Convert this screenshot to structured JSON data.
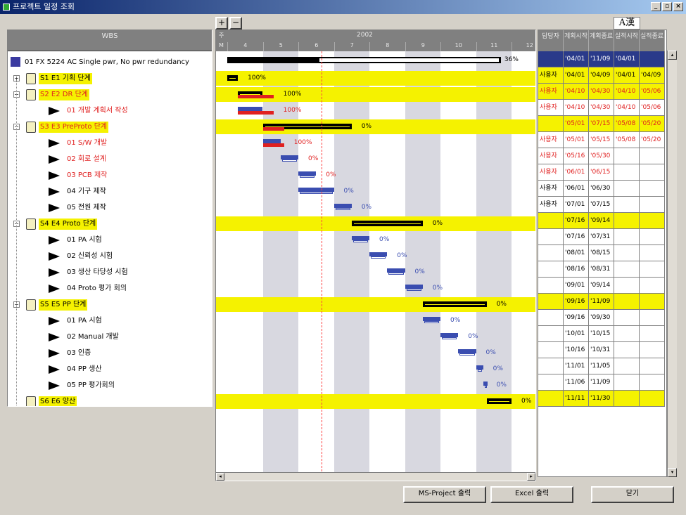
{
  "window": {
    "title": "프로젝트 일정 조회",
    "buttons": [
      "_",
      "▫",
      "×"
    ]
  },
  "ime": "A漢",
  "zoom": {
    "plus": "+",
    "minus": "−"
  },
  "wbs": {
    "header": "WBS",
    "project": "01 FX 5224 AC Single pwr, No pwr redundancy",
    "rows": [
      {
        "label": "S1 E1 기획 단계",
        "level": 0,
        "hl": true,
        "red": false,
        "toggle": "+"
      },
      {
        "label": "S2 E2 DR 단계",
        "level": 0,
        "hl": true,
        "red": true,
        "toggle": "−"
      },
      {
        "label": "01 개발 계획서 작성",
        "level": 1,
        "hl": false,
        "red": true
      },
      {
        "label": "S3 E3 PreProto 단계",
        "level": 0,
        "hl": true,
        "red": true,
        "toggle": "−"
      },
      {
        "label": "01 S/W 개발",
        "level": 1,
        "hl": false,
        "red": true
      },
      {
        "label": "02 회로 설계",
        "level": 1,
        "hl": false,
        "red": true
      },
      {
        "label": "03 PCB 제작",
        "level": 1,
        "hl": false,
        "red": true
      },
      {
        "label": "04 기구 제작",
        "level": 1,
        "hl": false,
        "red": false
      },
      {
        "label": "05 전원 제작",
        "level": 1,
        "hl": false,
        "red": false
      },
      {
        "label": "S4 E4 Proto 단계",
        "level": 0,
        "hl": true,
        "red": false,
        "toggle": "−"
      },
      {
        "label": "01 PA 시험",
        "level": 1,
        "hl": false,
        "red": false
      },
      {
        "label": "02 신뢰성 시험",
        "level": 1,
        "hl": false,
        "red": false
      },
      {
        "label": "03 생산 타당성 시험",
        "level": 1,
        "hl": false,
        "red": false
      },
      {
        "label": "04 Proto 평가 회의",
        "level": 1,
        "hl": false,
        "red": false
      },
      {
        "label": "S5 E5 PP 단계",
        "level": 0,
        "hl": true,
        "red": false,
        "toggle": "−"
      },
      {
        "label": "01 PA 시험",
        "level": 1,
        "hl": false,
        "red": false
      },
      {
        "label": "02 Manual 개발",
        "level": 1,
        "hl": false,
        "red": false
      },
      {
        "label": "03 인증",
        "level": 1,
        "hl": false,
        "red": false
      },
      {
        "label": "04 PP 생산",
        "level": 1,
        "hl": false,
        "red": false
      },
      {
        "label": "05 PP 평가회의",
        "level": 1,
        "hl": false,
        "red": false
      },
      {
        "label": "S6 E6 양산",
        "level": 0,
        "hl": true,
        "red": false,
        "toggle": ""
      }
    ]
  },
  "gantt": {
    "year": "2002",
    "row_marks": [
      "주",
      "M"
    ],
    "months": [
      "4",
      "5",
      "6",
      "7",
      "8",
      "9",
      "10",
      "11",
      "12"
    ],
    "summary_pct": "36%",
    "rows": [
      {
        "pct": "100%",
        "plan": [
          0.0,
          0.3
        ],
        "actual": null,
        "summary": true
      },
      {
        "pct": "100%",
        "plan": [
          0.3,
          1.0
        ],
        "actual": [
          0.3,
          1.3
        ],
        "summary": true
      },
      {
        "pct": "100%",
        "plan": [
          0.3,
          1.0
        ],
        "actual": [
          0.3,
          1.3
        ],
        "summary": false
      },
      {
        "pct": "0%",
        "plan": [
          1.0,
          3.5
        ],
        "actual": [
          1.0,
          1.6
        ],
        "summary": true
      },
      {
        "pct": "100%",
        "plan": [
          1.0,
          1.5
        ],
        "actual": [
          1.0,
          1.6
        ],
        "summary": false
      },
      {
        "pct": "0%",
        "plan": [
          1.5,
          2.0
        ],
        "actual": null,
        "summary": false
      },
      {
        "pct": "0%",
        "plan": [
          2.0,
          2.5
        ],
        "actual": null,
        "summary": false
      },
      {
        "pct": "0%",
        "plan": [
          2.0,
          3.0
        ],
        "actual": null,
        "summary": false
      },
      {
        "pct": "0%",
        "plan": [
          3.0,
          3.5
        ],
        "actual": null,
        "summary": false
      },
      {
        "pct": "0%",
        "plan": [
          3.5,
          5.5
        ],
        "actual": null,
        "summary": true
      },
      {
        "pct": "0%",
        "plan": [
          3.5,
          4.0
        ],
        "actual": null,
        "summary": false
      },
      {
        "pct": "0%",
        "plan": [
          4.0,
          4.5
        ],
        "actual": null,
        "summary": false
      },
      {
        "pct": "0%",
        "plan": [
          4.5,
          5.0
        ],
        "actual": null,
        "summary": false
      },
      {
        "pct": "0%",
        "plan": [
          5.0,
          5.5
        ],
        "actual": null,
        "summary": false
      },
      {
        "pct": "0%",
        "plan": [
          5.5,
          7.3
        ],
        "actual": null,
        "summary": true
      },
      {
        "pct": "0%",
        "plan": [
          5.5,
          6.0
        ],
        "actual": null,
        "summary": false
      },
      {
        "pct": "0%",
        "plan": [
          6.0,
          6.5
        ],
        "actual": null,
        "summary": false
      },
      {
        "pct": "0%",
        "plan": [
          6.5,
          7.0
        ],
        "actual": null,
        "summary": false
      },
      {
        "pct": "0%",
        "plan": [
          7.0,
          7.2
        ],
        "actual": null,
        "summary": false
      },
      {
        "pct": "0%",
        "plan": [
          7.2,
          7.3
        ],
        "actual": null,
        "summary": false
      },
      {
        "pct": "0%",
        "plan": [
          7.3,
          8.0
        ],
        "actual": null,
        "summary": true
      }
    ]
  },
  "dates": {
    "headers": [
      "담당자",
      "계획시작",
      "계획종료",
      "실적시작",
      "실적종료"
    ],
    "project_row": [
      "",
      "'04/01",
      "'11/09",
      "'04/01",
      ""
    ],
    "rows": [
      [
        "사용자",
        "'04/01",
        "'04/09",
        "'04/01",
        "'04/09"
      ],
      [
        "사용자",
        "'04/10",
        "'04/30",
        "'04/10",
        "'05/06"
      ],
      [
        "사용자",
        "'04/10",
        "'04/30",
        "'04/10",
        "'05/06"
      ],
      [
        "",
        "'05/01",
        "'07/15",
        "'05/08",
        "'05/20"
      ],
      [
        "사용자",
        "'05/01",
        "'05/15",
        "'05/08",
        "'05/20"
      ],
      [
        "사용자",
        "'05/16",
        "'05/30",
        "",
        ""
      ],
      [
        "사용자",
        "'06/01",
        "'06/15",
        "",
        ""
      ],
      [
        "사용자",
        "'06/01",
        "'06/30",
        "",
        ""
      ],
      [
        "사용자",
        "'07/01",
        "'07/15",
        "",
        ""
      ],
      [
        "",
        "'07/16",
        "'09/14",
        "",
        ""
      ],
      [
        "",
        "'07/16",
        "'07/31",
        "",
        ""
      ],
      [
        "",
        "'08/01",
        "'08/15",
        "",
        ""
      ],
      [
        "",
        "'08/16",
        "'08/31",
        "",
        ""
      ],
      [
        "",
        "'09/01",
        "'09/14",
        "",
        ""
      ],
      [
        "",
        "'09/16",
        "'11/09",
        "",
        ""
      ],
      [
        "",
        "'09/16",
        "'09/30",
        "",
        ""
      ],
      [
        "",
        "'10/01",
        "'10/15",
        "",
        ""
      ],
      [
        "",
        "'10/16",
        "'10/31",
        "",
        ""
      ],
      [
        "",
        "'11/01",
        "'11/05",
        "",
        ""
      ],
      [
        "",
        "'11/06",
        "'11/09",
        "",
        ""
      ],
      [
        "",
        "'11/11",
        "'11/30",
        "",
        ""
      ]
    ]
  },
  "footer": {
    "ms_project": "MS-Project 출력",
    "excel": "Excel 출력",
    "close": "닫기"
  },
  "colors": {
    "highlight": "#f5f200",
    "plan": "#3a4db0",
    "actual": "#e02020",
    "today": "#ff4040"
  }
}
